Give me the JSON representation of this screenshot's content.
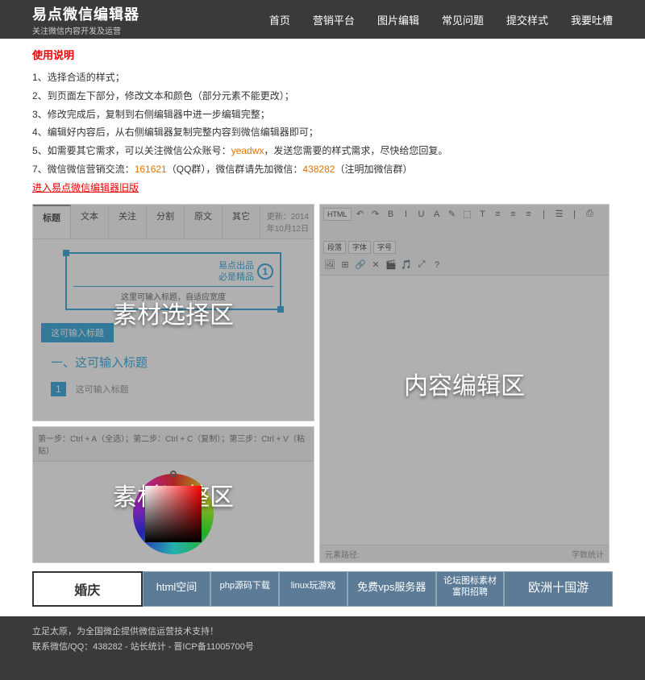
{
  "header": {
    "logo": "易点微信编辑器",
    "sub": "关注微信内容开发及运营",
    "nav": [
      "首页",
      "营销平台",
      "图片编辑",
      "常见问题",
      "提交样式",
      "我要吐槽"
    ]
  },
  "usage": {
    "title": "使用说明",
    "items": [
      {
        "n": "1、",
        "text": "选择合适的样式；"
      },
      {
        "n": "2、",
        "text": "到页面左下部分，修改文本和颜色（部分元素不能更改）；"
      },
      {
        "n": "3、",
        "text": "修改完成后，复制到右侧编辑器中进一步编辑完整；"
      },
      {
        "n": "4、",
        "text": "编辑好内容后，从右侧编辑器复制完整内容到微信编辑器即可；"
      }
    ],
    "item5_pre": "5、如需要其它需求，可以关注微信公众账号：",
    "item5_hl": "yeadwx",
    "item5_post": "，发送您需要的样式需求，尽快给您回复。",
    "item7_pre": "7、微信微信营销交流：",
    "item7_hl1": "161621",
    "item7_mid1": "（QQ群），微信群请先加微信：",
    "item7_hl2": "438282",
    "item7_post": "（注明加微信群）",
    "old_link": "进入易点微信编辑器旧版"
  },
  "materialPanel": {
    "tabs": [
      "标题",
      "文本",
      "关注",
      "分割",
      "原文",
      "其它"
    ],
    "date": "更新：2014年10月12日",
    "showcase_l1": "易点出品",
    "showcase_l2": "必是精品",
    "num": "1",
    "showcase_sub": "这里可输入标题，自适应宽度",
    "btn": "这可输入标题",
    "heading": "一、这可输入标题",
    "numlabel": "1",
    "cutoff": "这可输入标题",
    "overlay": "素材选择区"
  },
  "editorPanel": {
    "toolbar_row1": [
      "↶",
      "↷",
      "|",
      "B",
      "I",
      "U",
      "A",
      "✎",
      "⬚",
      "T",
      "|",
      "⬅",
      "↔",
      "⬇",
      "|",
      "≡",
      "≡",
      "≡",
      "≡",
      "|",
      "A",
      "A",
      "|",
      "☰",
      "☰",
      "|",
      "⎘",
      "⎙"
    ],
    "toolbar_row2": [
      "段落",
      "字体",
      "字号"
    ],
    "toolbar_row3": [
      "🖼",
      "≣",
      "⊞",
      "⊞",
      "−",
      "🔗",
      "✕",
      "🎬",
      "🎵",
      "⊞",
      "⤢",
      "|",
      "☰",
      "☰",
      "|",
      "?",
      "|",
      "☰",
      "☰",
      "◐",
      "⊡"
    ],
    "html_label": "HTML",
    "footer_left": "元素路径:",
    "footer_right": "字数统计",
    "overlay": "内容编辑区"
  },
  "adjustPanel": {
    "steps": "第一步：Ctrl + A（全选）；第二步：Ctrl + C（复制）；第三步：Ctrl + V（粘贴）",
    "overlay": "素材调整区"
  },
  "links": {
    "l1": "婚庆",
    "l2": "html空间",
    "l3": "php源码下载",
    "l4": "linux玩游戏",
    "l5": "免费vps服务器",
    "l6a": "论坛图标素材",
    "l6b": "富阳招聘",
    "l7": "欧洲十国游"
  },
  "footer": {
    "l1": "立足太原，为全国微企提供微信运营技术支持！",
    "l2": "联系微信/QQ：438282 - 站长统计 - 晋ICP备11005700号"
  }
}
